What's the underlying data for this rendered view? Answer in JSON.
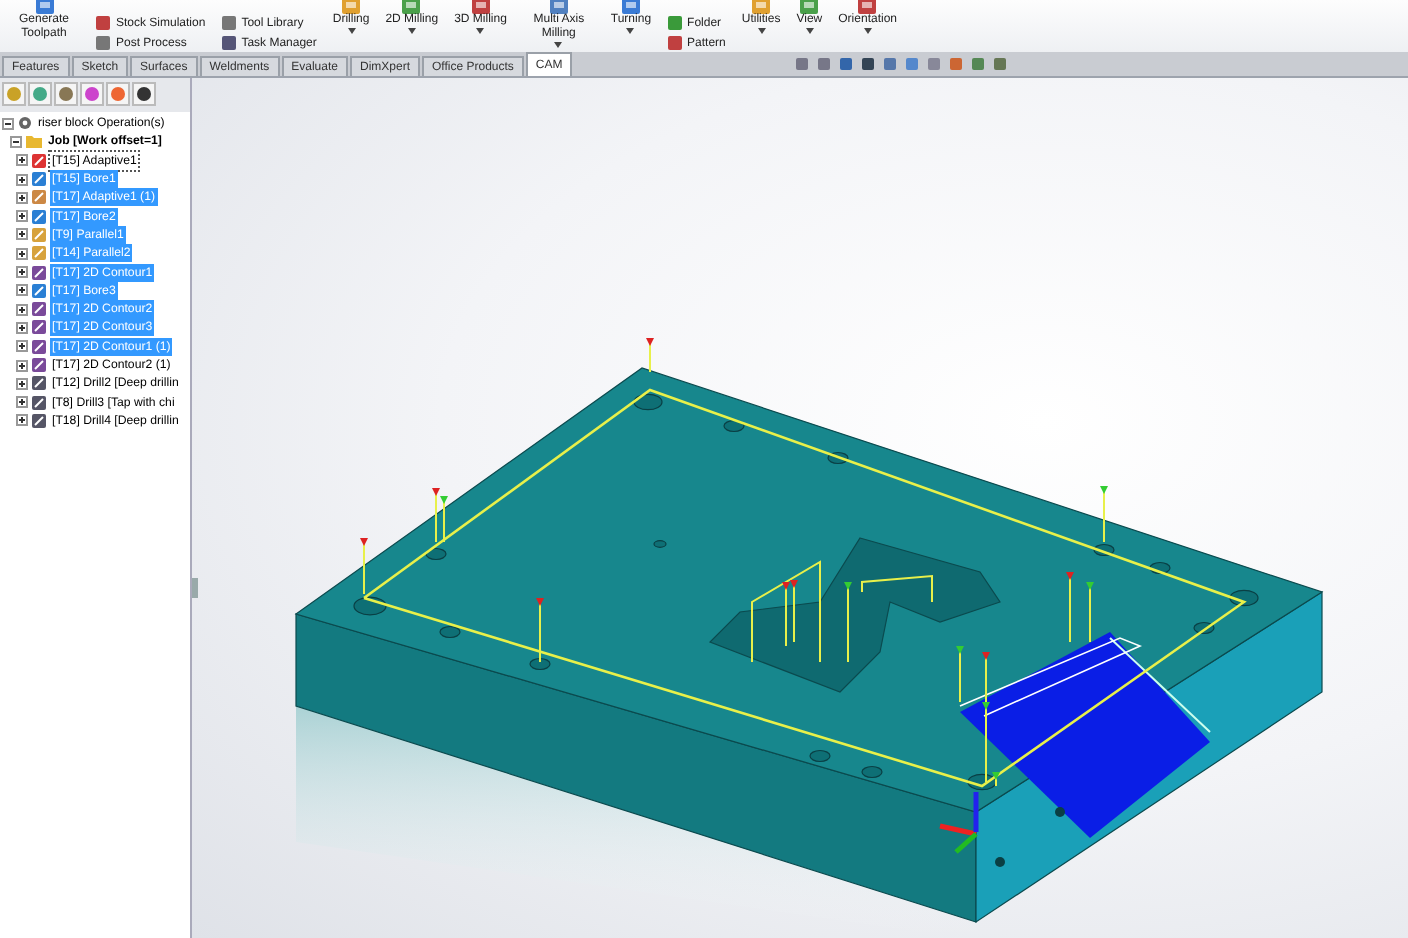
{
  "ribbon": [
    {
      "kind": "large",
      "label": "Generate Toolpath",
      "dropdown": false
    },
    {
      "kind": "stack",
      "items": [
        "Stock Simulation",
        "Post Process"
      ]
    },
    {
      "kind": "stack",
      "items": [
        "Tool Library",
        "Task Manager"
      ]
    },
    {
      "kind": "large",
      "label": "Drilling",
      "dropdown": true
    },
    {
      "kind": "large",
      "label": "2D Milling",
      "dropdown": true
    },
    {
      "kind": "large",
      "label": "3D Milling",
      "dropdown": true
    },
    {
      "kind": "large",
      "label": "Multi Axis Milling",
      "dropdown": true
    },
    {
      "kind": "large",
      "label": "Turning",
      "dropdown": true
    },
    {
      "kind": "stack",
      "items": [
        "Folder",
        "Pattern"
      ]
    },
    {
      "kind": "large",
      "label": "Utilities",
      "dropdown": true
    },
    {
      "kind": "large",
      "label": "View",
      "dropdown": true
    },
    {
      "kind": "large",
      "label": "Orientation",
      "dropdown": true
    }
  ],
  "tabs": [
    {
      "label": "Features",
      "selected": false
    },
    {
      "label": "Sketch",
      "selected": false
    },
    {
      "label": "Surfaces",
      "selected": false
    },
    {
      "label": "Weldments",
      "selected": false
    },
    {
      "label": "Evaluate",
      "selected": false
    },
    {
      "label": "DimXpert",
      "selected": false
    },
    {
      "label": "Office Products",
      "selected": false
    },
    {
      "label": "CAM",
      "selected": true
    }
  ],
  "tree": {
    "label": "riser block Operation(s)",
    "expanded": true,
    "children": [
      {
        "label": "Job [Work offset=1]",
        "expanded": true,
        "children": [
          {
            "label": "[T15] Adaptive1",
            "selected": false,
            "expanded": false
          },
          {
            "label": "[T15] Bore1",
            "selected": true,
            "expanded": false
          },
          {
            "label": "[T17] Adaptive1 (1)",
            "selected": true,
            "expanded": false
          },
          {
            "label": "[T17] Bore2",
            "selected": true,
            "expanded": false
          },
          {
            "label": "[T9] Parallel1",
            "selected": true,
            "expanded": false
          },
          {
            "label": "[T14] Parallel2",
            "selected": true,
            "expanded": false
          },
          {
            "label": "[T17] 2D Contour1",
            "selected": true,
            "expanded": false
          },
          {
            "label": "[T17] Bore3",
            "selected": true,
            "expanded": false
          },
          {
            "label": "[T17] 2D Contour2",
            "selected": true,
            "expanded": false
          },
          {
            "label": "[T17] 2D Contour3",
            "selected": true,
            "expanded": false
          },
          {
            "label": "[T17] 2D Contour1 (1)",
            "selected": true,
            "expanded": false
          },
          {
            "label": "[T17] 2D Contour2 (1)",
            "selected": false,
            "expanded": false
          },
          {
            "label": "[T12] Drill2 [Deep drillin",
            "selected": false,
            "expanded": false
          },
          {
            "label": "[T8] Drill3 [Tap with chi",
            "selected": false,
            "expanded": false
          },
          {
            "label": "[T18] Drill4 [Deep drillin",
            "selected": false,
            "expanded": false
          }
        ]
      }
    ]
  }
}
